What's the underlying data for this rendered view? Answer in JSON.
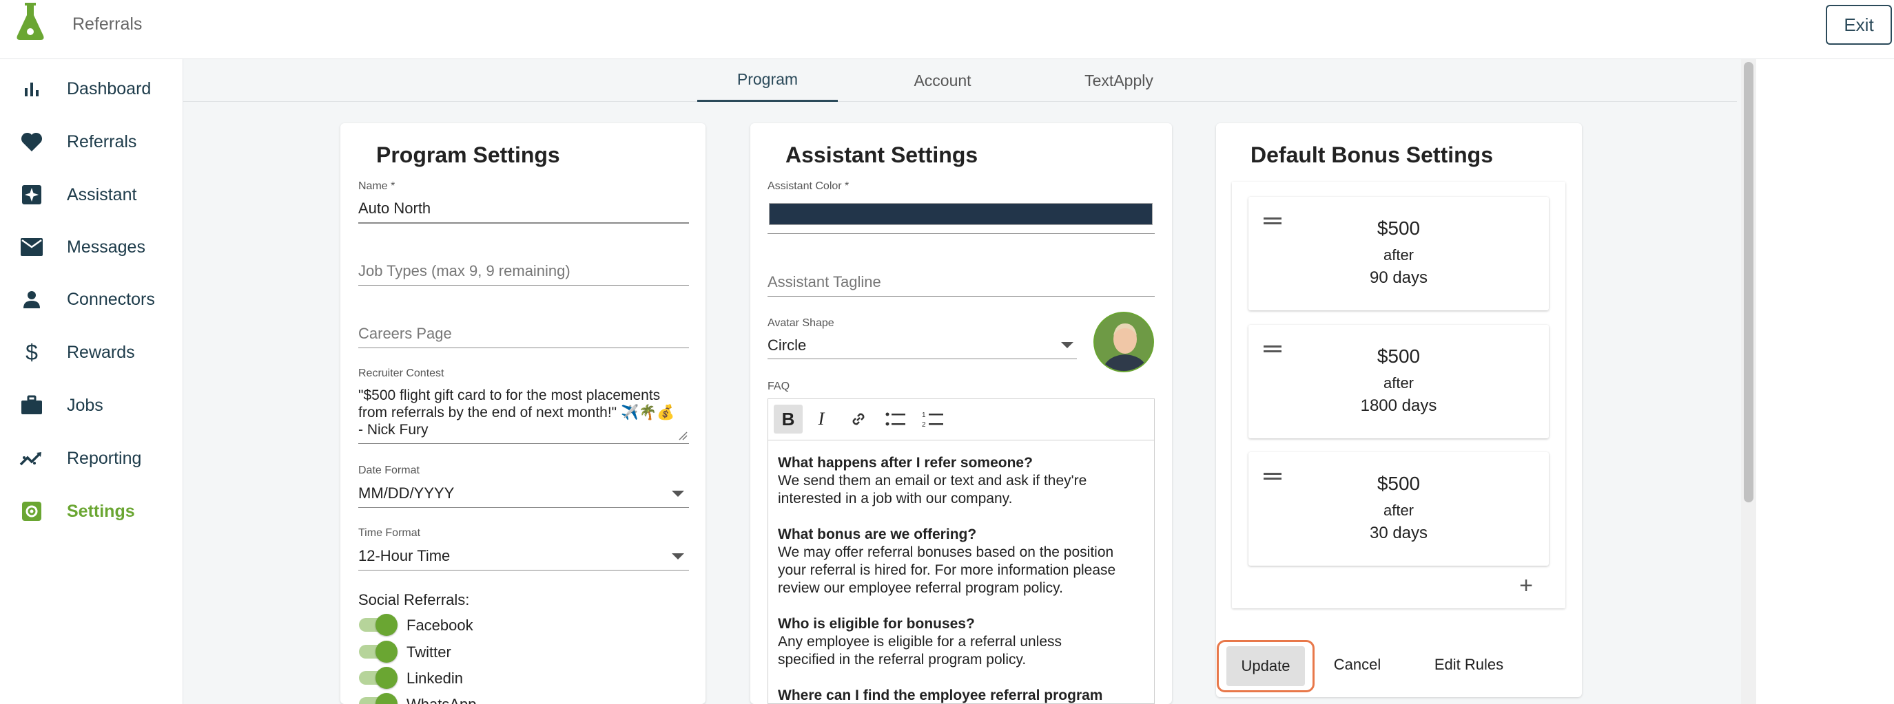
{
  "app": {
    "title": "Referrals",
    "exit_label": "Exit"
  },
  "colors": {
    "brand_green": "#6aa632",
    "nav_text": "#1d3b4a",
    "assistant_color": "#22354a",
    "highlight": "#e8784a"
  },
  "sidebar": {
    "items": [
      {
        "label": "Dashboard",
        "icon": "bar-chart-icon"
      },
      {
        "label": "Referrals",
        "icon": "heart-icon"
      },
      {
        "label": "Assistant",
        "icon": "sparkle-icon"
      },
      {
        "label": "Messages",
        "icon": "envelope-icon"
      },
      {
        "label": "Connectors",
        "icon": "person-icon"
      },
      {
        "label": "Rewards",
        "icon": "dollar-icon"
      },
      {
        "label": "Jobs",
        "icon": "briefcase-icon"
      },
      {
        "label": "Reporting",
        "icon": "trend-icon"
      },
      {
        "label": "Settings",
        "icon": "settings-icon",
        "active": true
      }
    ]
  },
  "tabs": [
    {
      "label": "Program",
      "active": true
    },
    {
      "label": "Account"
    },
    {
      "label": "TextApply"
    }
  ],
  "program": {
    "title": "Program Settings",
    "name_label": "Name *",
    "name_value": "Auto North",
    "job_types_placeholder": "Job Types (max 9, 9 remaining)",
    "careers_placeholder": "Careers Page",
    "contest_label": "Recruiter Contest",
    "contest_line1": "\"$500 flight gift card to for the most placements",
    "contest_line2": "from referrals by the end of next month!\" ✈️🌴💰",
    "contest_line3": "- Nick Fury",
    "date_format_label": "Date Format",
    "date_format_value": "MM/DD/YYYY",
    "time_format_label": "Time Format",
    "time_format_value": "12-Hour Time",
    "social_label": "Social Referrals:",
    "social": [
      {
        "label": "Facebook",
        "on": true
      },
      {
        "label": "Twitter",
        "on": true
      },
      {
        "label": "Linkedin",
        "on": true
      },
      {
        "label": "WhatsApp",
        "on": true
      }
    ]
  },
  "assistant": {
    "title": "Assistant Settings",
    "color_label": "Assistant Color *",
    "tagline_placeholder": "Assistant Tagline",
    "avatar_shape_label": "Avatar Shape",
    "avatar_shape_value": "Circle",
    "faq_label": "FAQ",
    "toolbar": [
      "bold-icon",
      "italic-icon",
      "link-icon",
      "bulleted-list-icon",
      "numbered-list-icon"
    ],
    "faq": {
      "q1": "What happens after I refer someone?",
      "a1_l1": "We send them an email or text and ask if they're",
      "a1_l2": "interested in a job with our company.",
      "q2": "What bonus are we offering?",
      "a2_l1": "We may offer referral bonuses based on the position",
      "a2_l2": "your referral is hired for. For more information please",
      "a2_l3": "review our employee referral program policy.",
      "q3": "Who is eligible for bonuses?",
      "a3_l1": "Any employee is eligible for a referral unless",
      "a3_l2": "specified in the referral program policy.",
      "q4": "Where can I find the employee referral program"
    }
  },
  "bonus": {
    "title": "Default Bonus Settings",
    "items": [
      {
        "amount": "$500",
        "after": "after",
        "days": "90 days"
      },
      {
        "amount": "$500",
        "after": "after",
        "days": "1800 days"
      },
      {
        "amount": "$500",
        "after": "after",
        "days": "30 days"
      }
    ],
    "add_label": "+",
    "update_label": "Update",
    "cancel_label": "Cancel",
    "edit_rules_label": "Edit Rules"
  }
}
